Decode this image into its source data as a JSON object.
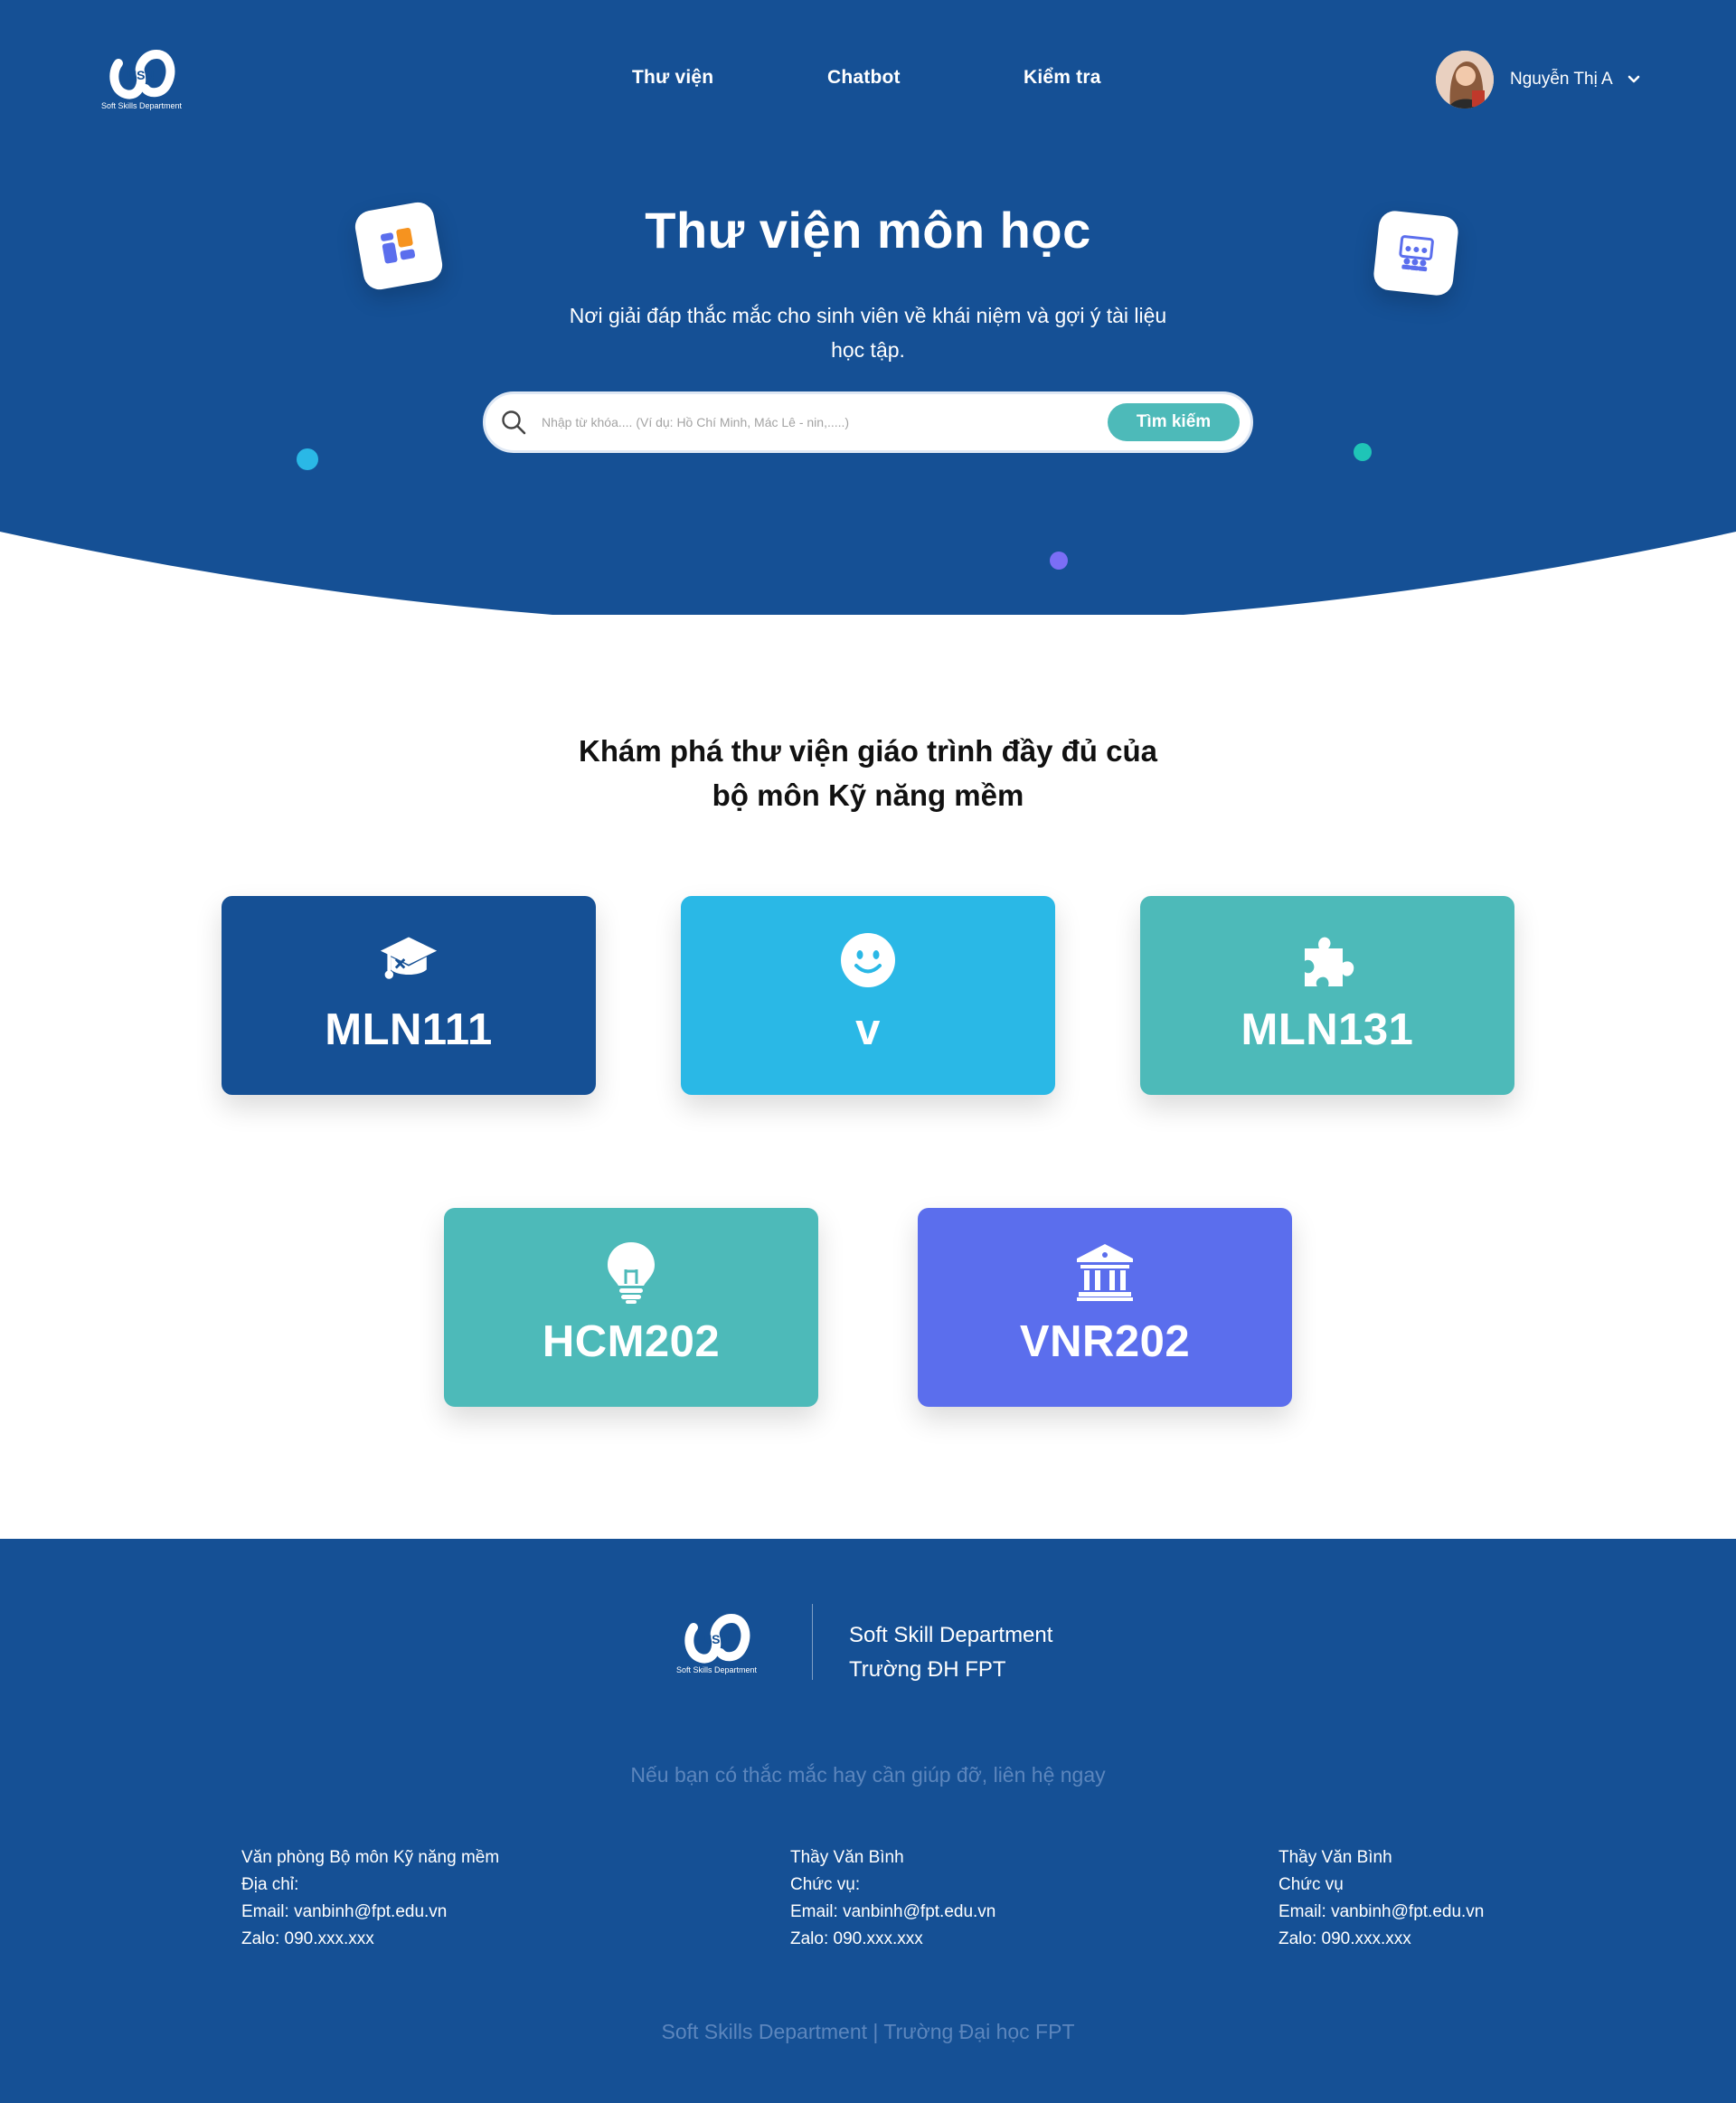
{
  "brand": {
    "logo_text": "Soft Skills Department"
  },
  "nav": {
    "items": [
      {
        "label": "Thư viện"
      },
      {
        "label": "Chatbot"
      },
      {
        "label": "Kiểm tra"
      }
    ]
  },
  "user": {
    "name": "Nguyễn Thị A",
    "avatar_icon": "user-avatar-photo",
    "menu_icon": "chevron-down-icon"
  },
  "hero": {
    "title": "Thư viện môn học",
    "subtitle": "Nơi giải đáp thắc mắc cho sinh viên về khái niệm và gợi ý tài liệu học tập.",
    "search": {
      "placeholder": "Nhập từ khóa.... (Ví dụ: Hồ Chí Minh, Mác Lê - nin,.....)",
      "button_label": "Tìm kiếm"
    }
  },
  "library": {
    "title_line1": "Khám phá thư viện giáo trình đầy đủ của",
    "title_line2": "bộ môn Kỹ năng mềm",
    "courses": [
      {
        "code": "MLN111",
        "icon": "graduation-cap-icon",
        "color": "#155095"
      },
      {
        "code": "v",
        "icon": "smiley-icon",
        "color": "#2ab8e6"
      },
      {
        "code": "MLN131",
        "icon": "puzzle-icon",
        "color": "#4dbab9"
      },
      {
        "code": "HCM202",
        "icon": "lightbulb-icon",
        "color": "#4dbab9"
      },
      {
        "code": "VNR202",
        "icon": "bank-icon",
        "color": "#5b6eed"
      }
    ]
  },
  "footer": {
    "logo_text": "Soft Skills Department",
    "org_line1": "Soft Skill Department",
    "org_line2": "Trường ĐH FPT",
    "contact_prompt": "Nếu bạn có thắc mắc hay cần giúp đỡ, liên hệ ngay",
    "contacts": [
      {
        "line1": "Văn phòng Bộ môn Kỹ năng mềm",
        "line2": "Địa chỉ:",
        "line3": "Email: vanbinh@fpt.edu.vn",
        "line4": "Zalo: 090.xxx.xxx"
      },
      {
        "line1": "Thầy Văn Bình",
        "line2": "Chức vụ:",
        "line3": "Email: vanbinh@fpt.edu.vn",
        "line4": "Zalo: 090.xxx.xxx"
      },
      {
        "line1": "Thầy Văn Bình",
        "line2": "Chức vụ",
        "line3": "Email: vanbinh@fpt.edu.vn",
        "line4": "Zalo: 090.xxx.xxx"
      }
    ],
    "copyright": "Soft Skills Department | Trường Đại học FPT"
  },
  "colors": {
    "primary": "#155095",
    "accent_teal": "#4dbab9",
    "accent_cyan": "#2ab8e6",
    "accent_indigo": "#5b6eed",
    "muted_text": "#5c86bd"
  }
}
